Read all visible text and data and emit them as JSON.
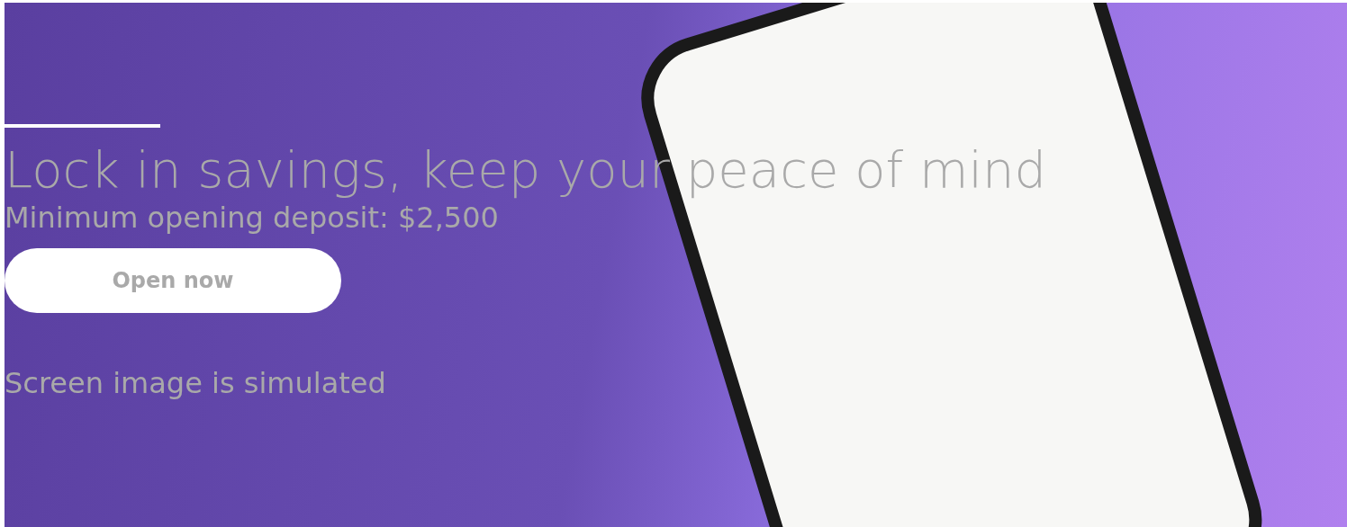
{
  "hero": {
    "heading": "Lock in savings, keep your peace of mind",
    "subheading": "Minimum opening deposit: $2,500",
    "button": {
      "label": "Open now"
    },
    "disclaimer": "Screen image is simulated"
  }
}
